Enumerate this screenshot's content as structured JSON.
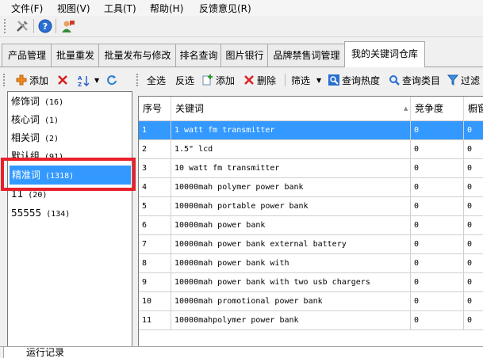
{
  "menu": [
    "文件(F)",
    "视图(V)",
    "工具(T)",
    "帮助(H)",
    "反馈意见(R)"
  ],
  "tabs": [
    "产品管理",
    "批量重发",
    "批量发布与修改",
    "排名查询",
    "图片银行",
    "品牌禁售词管理",
    "我的关键词仓库"
  ],
  "left_toolbar": {
    "add": "添加"
  },
  "main_toolbar": {
    "select_all": "全选",
    "invert": "反选",
    "add": "添加",
    "delete": "删除",
    "filter": "筛选",
    "query_heat": "查询热度",
    "query_category": "查询类目",
    "filter_word": "过滤"
  },
  "groups": [
    {
      "name": "修饰词",
      "count": "(16)"
    },
    {
      "name": "核心词",
      "count": "(1)"
    },
    {
      "name": "相关词",
      "count": "(2)"
    },
    {
      "name": "默认组",
      "count": "(91)"
    },
    {
      "name": "精准词",
      "count": "(1318)"
    },
    {
      "name": "11",
      "count": "(20)"
    },
    {
      "name": "55555",
      "count": "(134)"
    }
  ],
  "table": {
    "headers": [
      "序号",
      "关键词",
      "竞争度",
      "橱窗"
    ],
    "rows": [
      {
        "no": "1",
        "kw": "1 watt fm transmitter",
        "comp": "0",
        "win": "0"
      },
      {
        "no": "2",
        "kw": "1.5\" lcd",
        "comp": "0",
        "win": "0"
      },
      {
        "no": "3",
        "kw": "10 watt fm transmitter",
        "comp": "0",
        "win": "0"
      },
      {
        "no": "4",
        "kw": "10000mah polymer power bank",
        "comp": "0",
        "win": "0"
      },
      {
        "no": "5",
        "kw": "10000mah portable power bank",
        "comp": "0",
        "win": "0"
      },
      {
        "no": "6",
        "kw": "10000mah power bank",
        "comp": "0",
        "win": "0"
      },
      {
        "no": "7",
        "kw": "10000mah power bank external battery",
        "comp": "0",
        "win": "0"
      },
      {
        "no": "8",
        "kw": "10000mah power bank with",
        "comp": "0",
        "win": "0"
      },
      {
        "no": "9",
        "kw": "10000mah power bank with two usb chargers",
        "comp": "0",
        "win": "0"
      },
      {
        "no": "10",
        "kw": "10000mah promotional power bank",
        "comp": "0",
        "win": "0"
      },
      {
        "no": "11",
        "kw": "10000mahpolymer power bank",
        "comp": "0",
        "win": "0"
      }
    ]
  },
  "footer": {
    "label": "运行记录"
  },
  "colors": {
    "selection": "#3399ff",
    "highlight": "#e8202a"
  }
}
